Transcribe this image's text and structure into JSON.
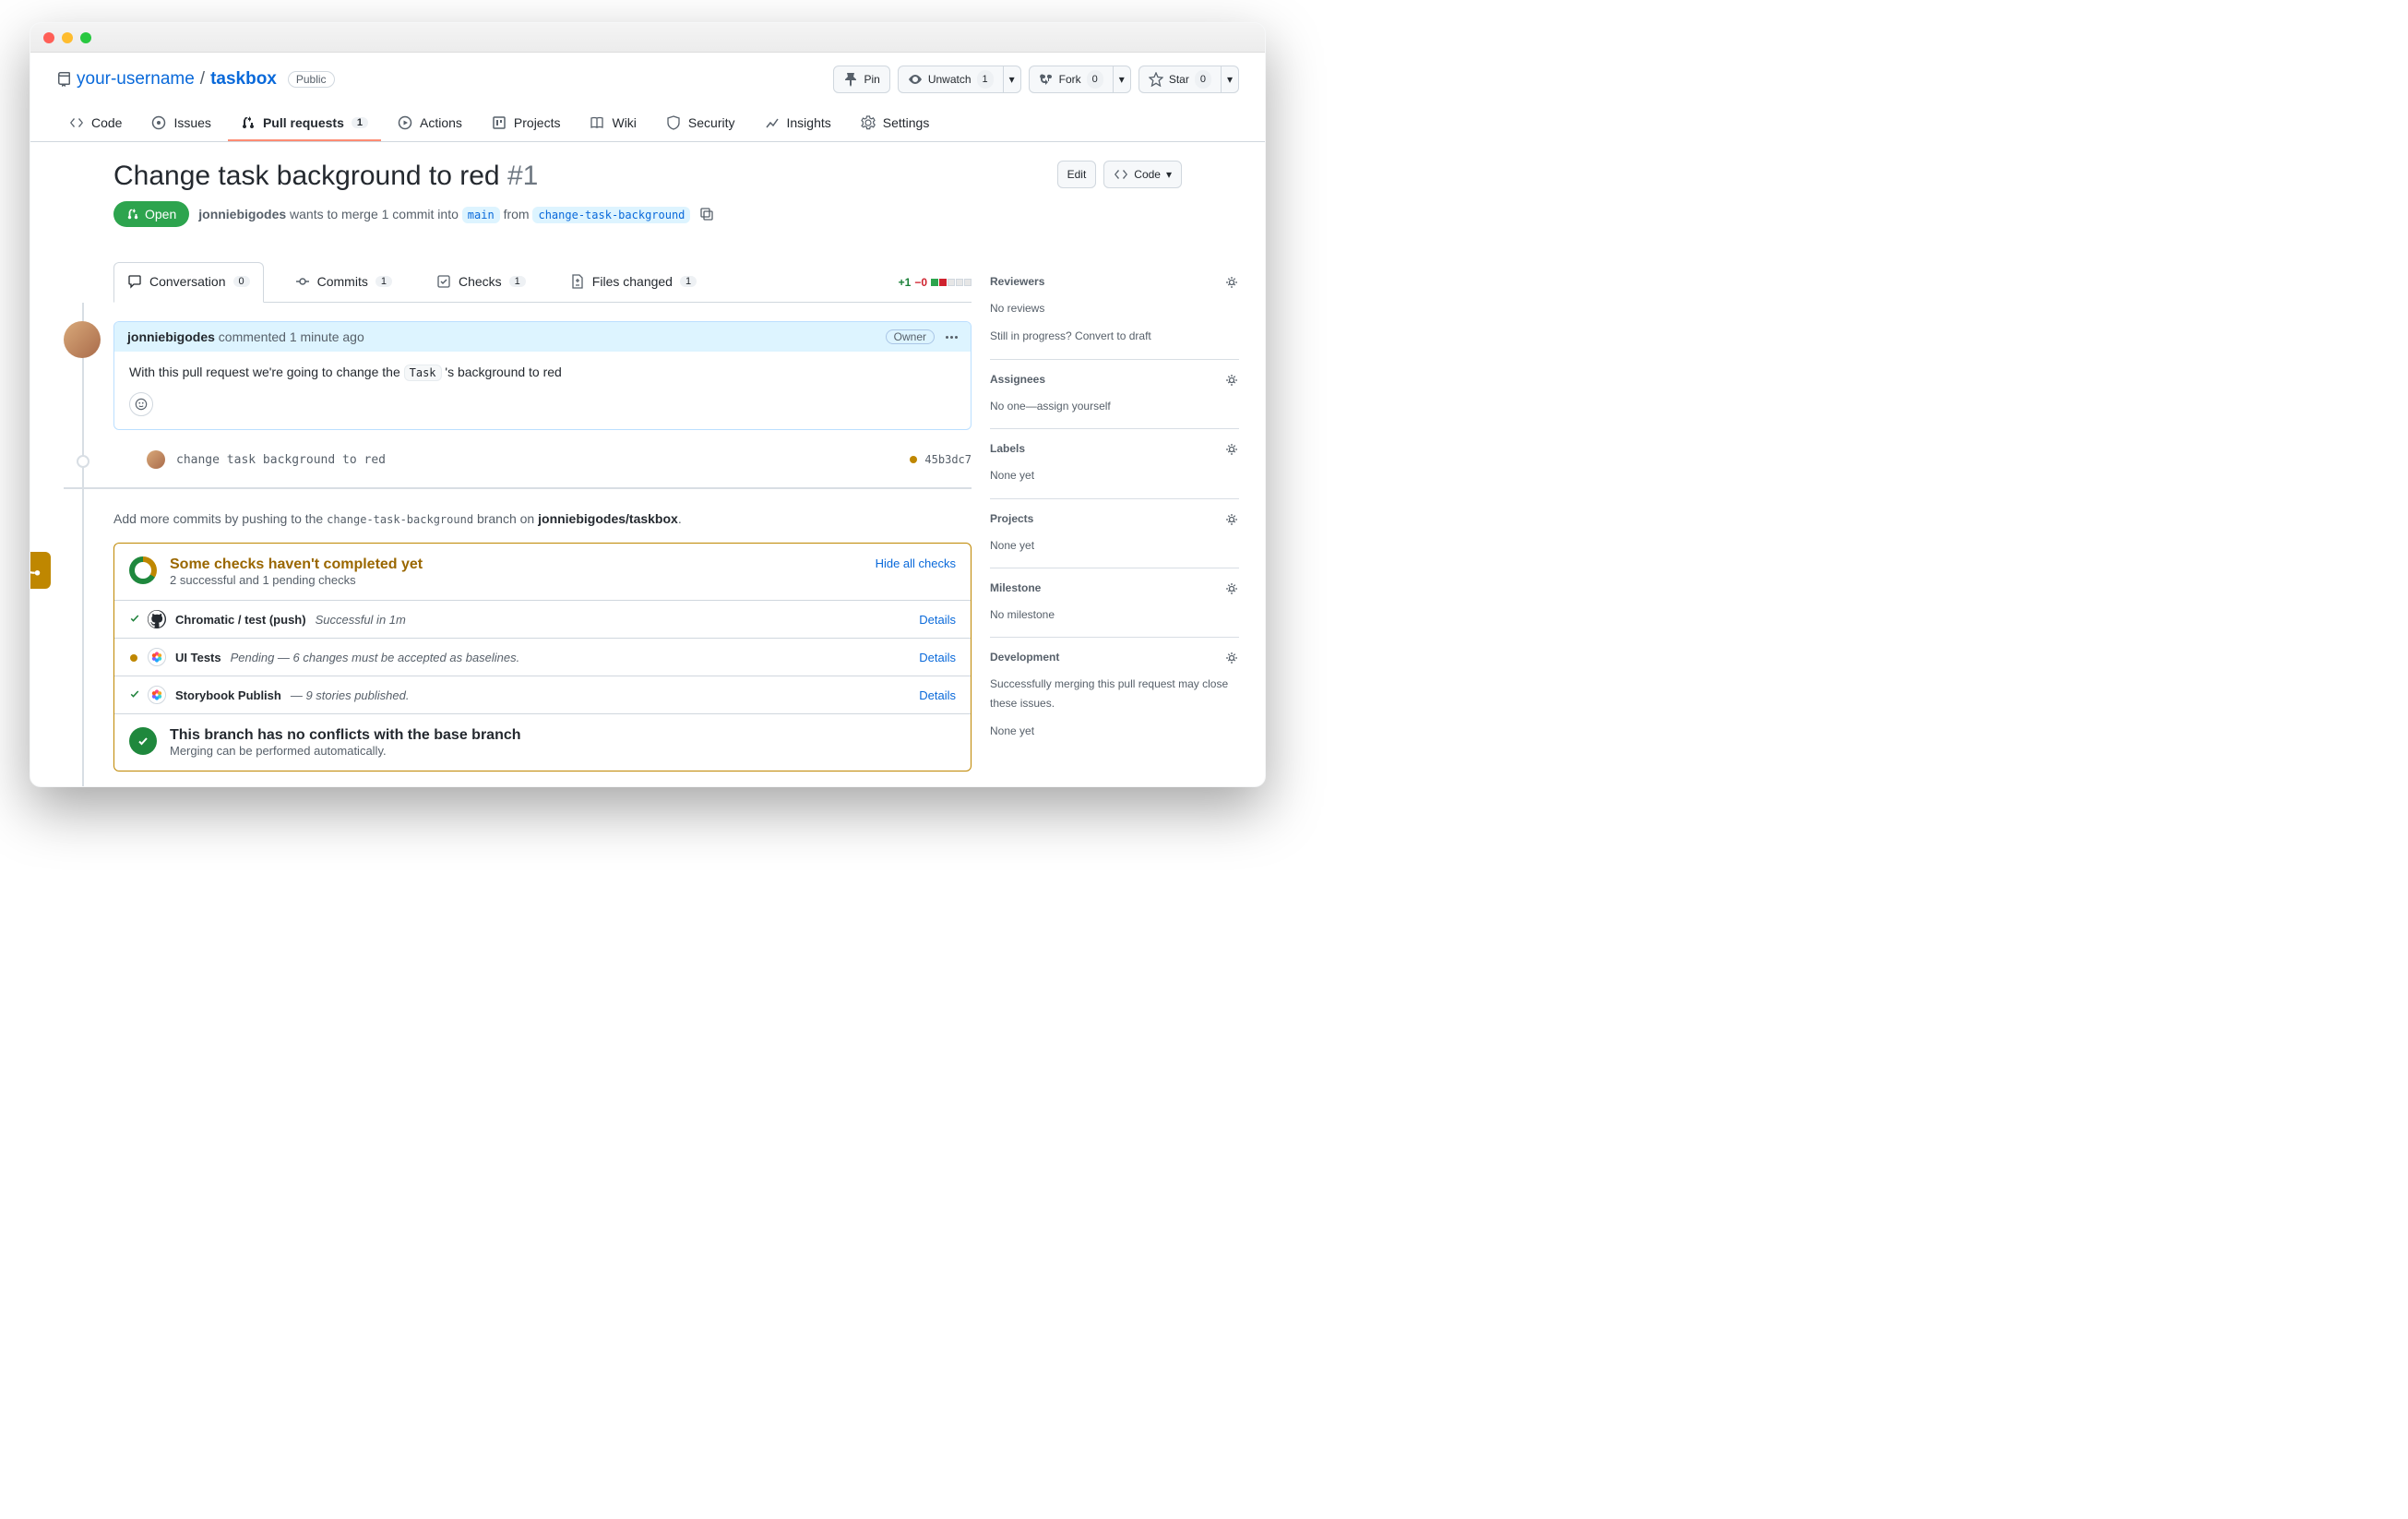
{
  "repo": {
    "owner": "your-username",
    "name": "taskbox",
    "visibility": "Public"
  },
  "header_actions": {
    "pin": "Pin",
    "unwatch": "Unwatch",
    "unwatch_count": "1",
    "fork": "Fork",
    "fork_count": "0",
    "star": "Star",
    "star_count": "0"
  },
  "nav": {
    "code": "Code",
    "issues": "Issues",
    "pulls": "Pull requests",
    "pulls_count": "1",
    "actions": "Actions",
    "projects": "Projects",
    "wiki": "Wiki",
    "security": "Security",
    "insights": "Insights",
    "settings": "Settings"
  },
  "pr": {
    "title": "Change task background to red",
    "number": "#1",
    "state": "Open",
    "author": "jonniebigodes",
    "wants": " wants to merge 1 commit into ",
    "base_branch": "main",
    "from_word": " from ",
    "head_branch": "change-task-background",
    "edit": "Edit",
    "code_btn": "Code"
  },
  "subtabs": {
    "conversation": "Conversation",
    "conversation_count": "0",
    "commits": "Commits",
    "commits_count": "1",
    "checks": "Checks",
    "checks_count": "1",
    "files": "Files changed",
    "files_count": "1"
  },
  "diffstat": {
    "add": "+1",
    "del": "−0"
  },
  "comment": {
    "author": "jonniebigodes",
    "time": " commented 1 minute ago",
    "owner": "Owner",
    "body_pre": "With this pull request we're going to change the ",
    "body_code": "Task",
    "body_post": " 's background to red"
  },
  "commit": {
    "message": "change task background to red",
    "sha": "45b3dc7"
  },
  "push_hint": {
    "prefix": "Add more commits by pushing to the ",
    "branch": "change-task-background",
    "middle": " branch on ",
    "target": "jonniebigodes/taskbox",
    "suffix": "."
  },
  "checks": {
    "title": "Some checks haven't completed yet",
    "subtitle": "2 successful and 1 pending checks",
    "hide": "Hide all checks",
    "items": [
      {
        "status": "ok",
        "name": "Chromatic / test (push)",
        "desc": "Successful in 1m",
        "details": "Details",
        "logo": "gh"
      },
      {
        "status": "pend",
        "name": "UI Tests",
        "desc": "Pending — 6 changes must be accepted as baselines.",
        "details": "Details",
        "logo": "chrom"
      },
      {
        "status": "ok",
        "name": "Storybook Publish",
        "desc": "— 9 stories published.",
        "details": "Details",
        "logo": "chrom"
      }
    ]
  },
  "merge": {
    "title": "This branch has no conflicts with the base branch",
    "subtitle": "Merging can be performed automatically."
  },
  "sidebar": {
    "reviewers": {
      "title": "Reviewers",
      "body": "No reviews",
      "hint_pre": "Still in progress? ",
      "hint_link": "Convert to draft"
    },
    "assignees": {
      "title": "Assignees",
      "body_pre": "No one—",
      "body_link": "assign yourself"
    },
    "labels": {
      "title": "Labels",
      "body": "None yet"
    },
    "projects": {
      "title": "Projects",
      "body": "None yet"
    },
    "milestone": {
      "title": "Milestone",
      "body": "No milestone"
    },
    "development": {
      "title": "Development",
      "body": "Successfully merging this pull request may close these issues.",
      "body2": "None yet"
    }
  }
}
